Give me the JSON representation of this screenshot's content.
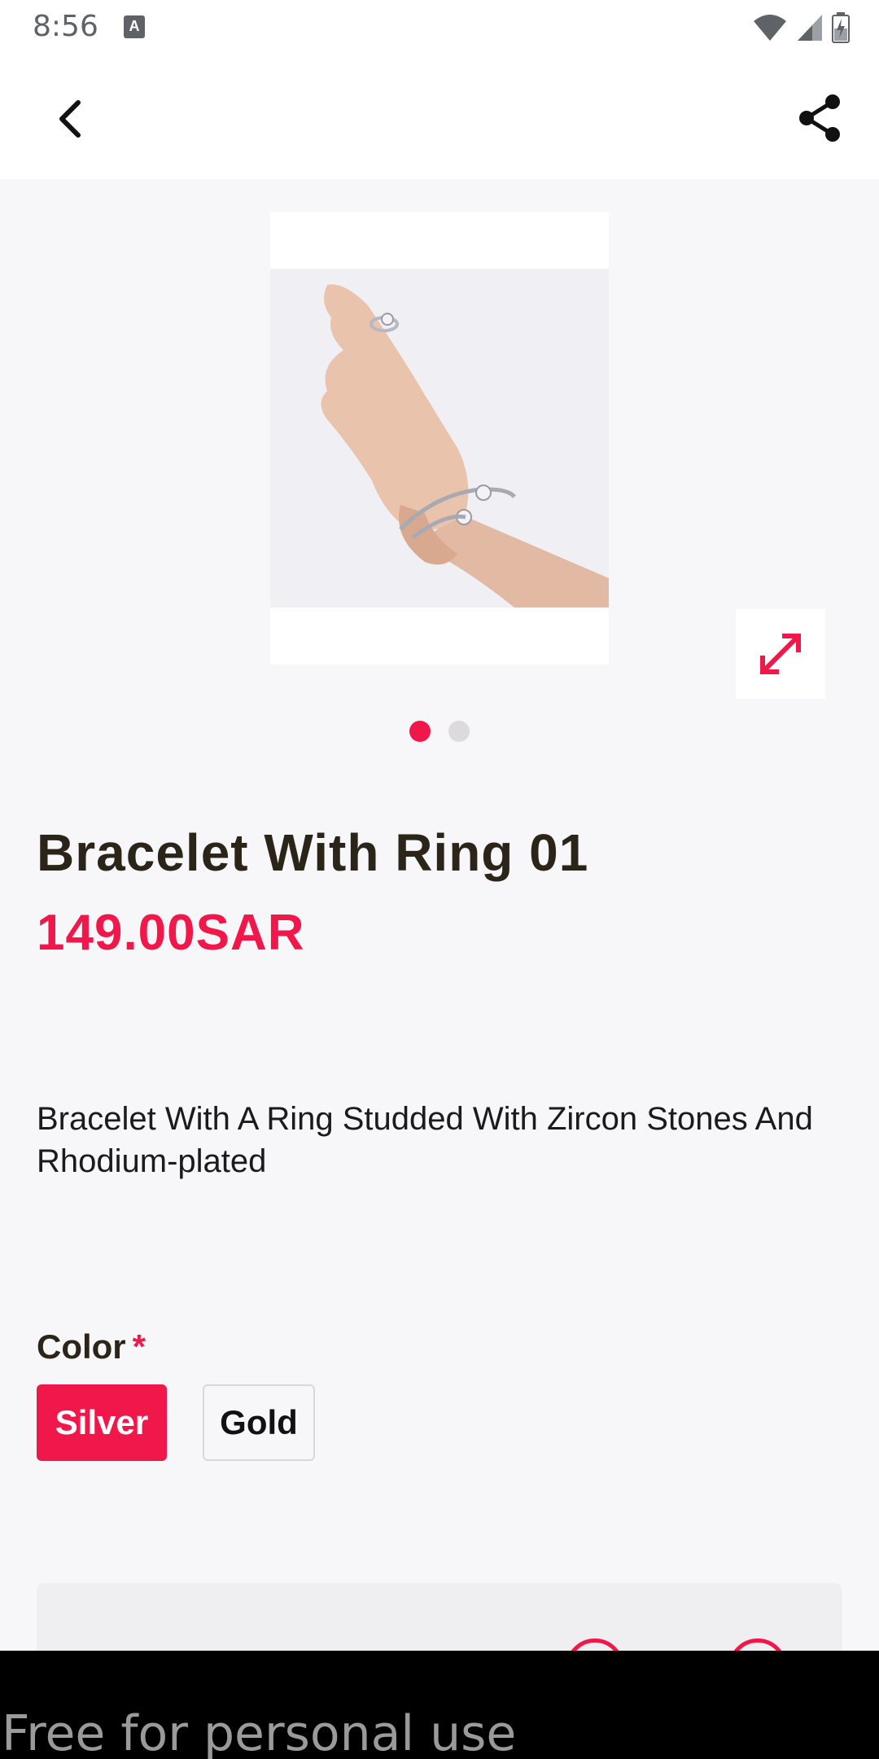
{
  "status_bar": {
    "time": "8:56",
    "notification_icon": "a-icon",
    "icons": [
      "wifi-icon",
      "signal-icon",
      "battery-charging-icon"
    ]
  },
  "app_bar": {
    "back_icon": "chevron-left-icon",
    "share_icon": "share-icon"
  },
  "gallery": {
    "image_count": 2,
    "active_index": 0,
    "expand_icon": "expand-icon",
    "image_subject": "hand-with-bracelet-and-ring"
  },
  "product": {
    "title": "Bracelet With Ring 01",
    "price": "149.00SAR",
    "description": "Bracelet With A Ring Studded With Zircon Stones And Rhodium-plated"
  },
  "options": {
    "color_label": "Color",
    "required_mark": "*",
    "colors": [
      {
        "label": "Silver",
        "selected": true
      },
      {
        "label": "Gold",
        "selected": false
      }
    ]
  },
  "watermark": "Free for personal use",
  "theme": {
    "accent": "#f0184a",
    "text_dark": "#2b2418",
    "background": "#f7f6f9"
  }
}
